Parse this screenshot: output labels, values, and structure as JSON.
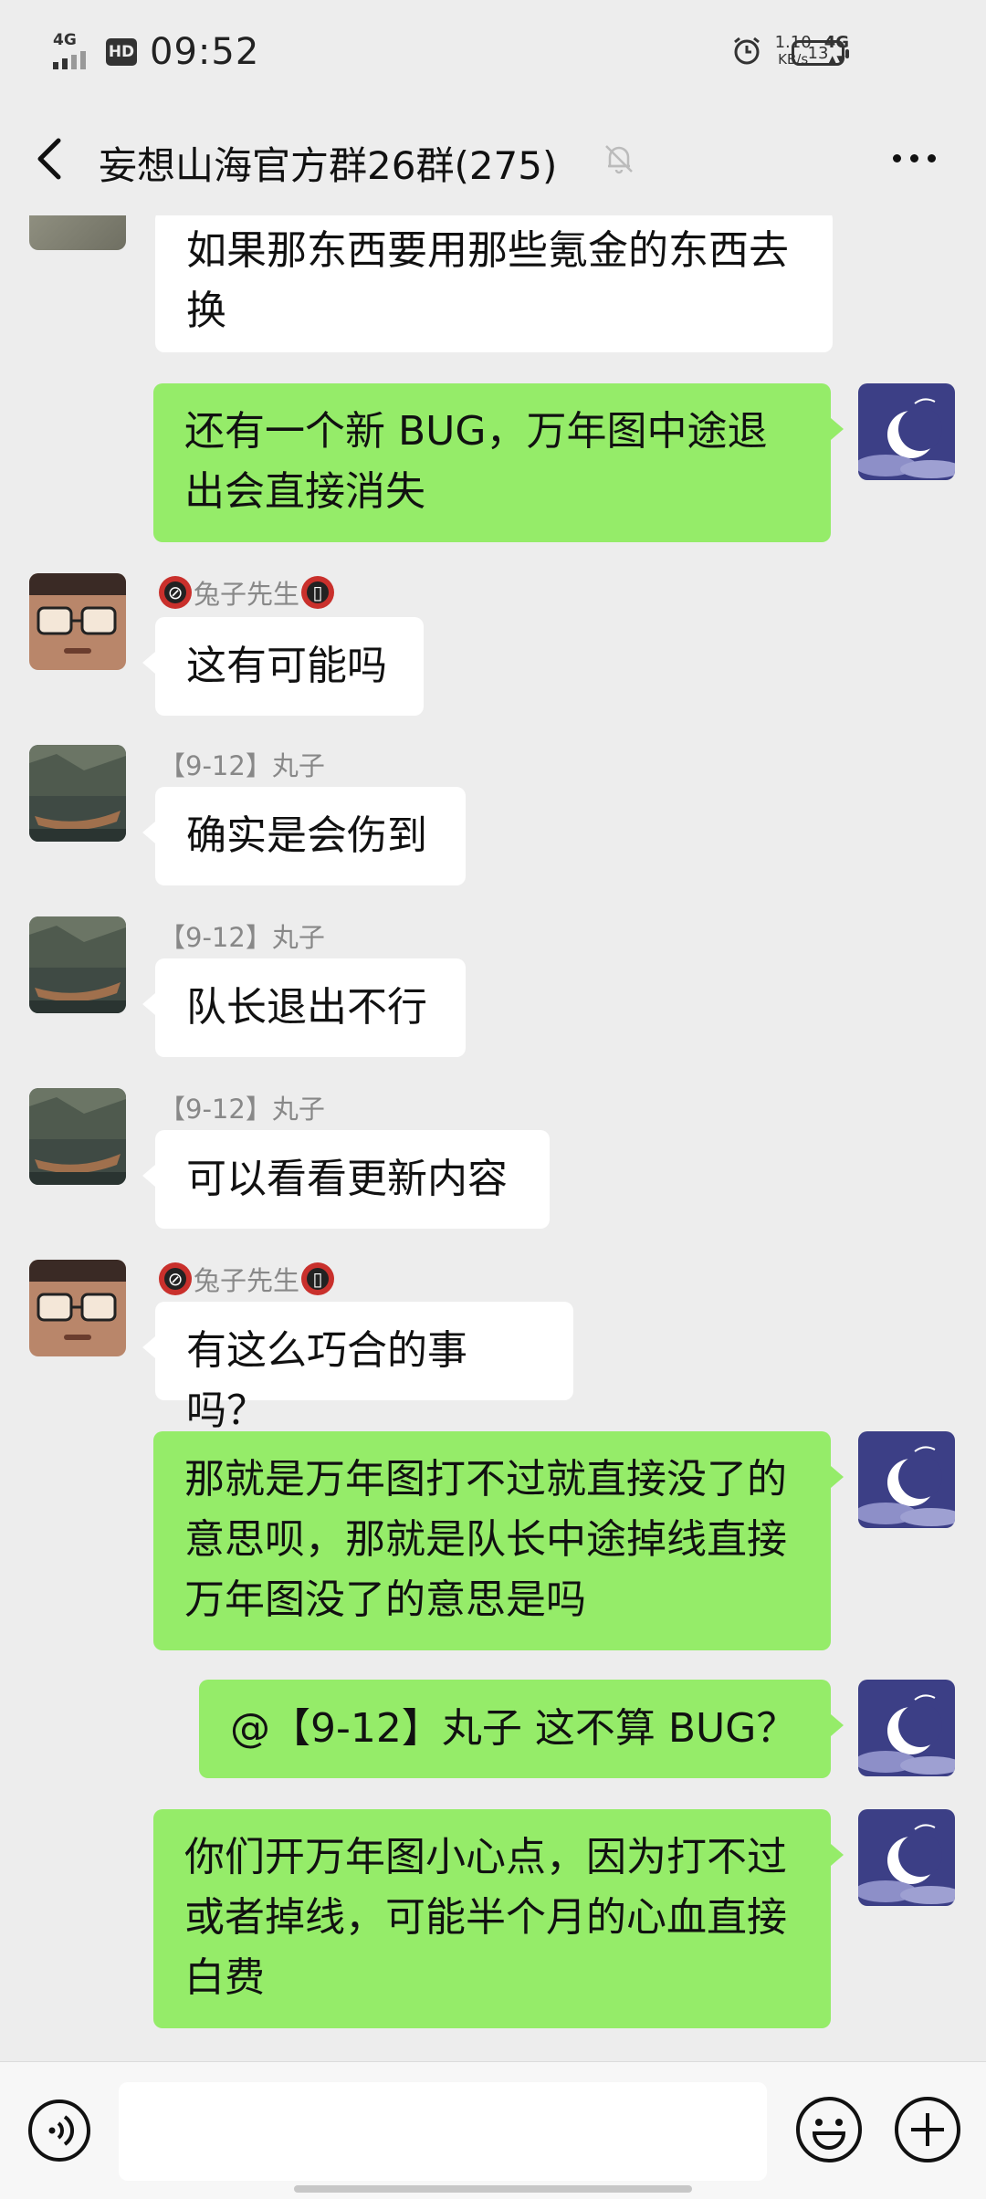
{
  "status_bar": {
    "network_label": "4G",
    "hd_label": "HD",
    "time": "09:52",
    "speed_value": "1.10",
    "speed_unit": "KB/s",
    "network_right": "4G",
    "battery": "13"
  },
  "header": {
    "title": "妄想山海官方群26群(275)"
  },
  "messages": [
    {
      "side": "left",
      "sender": "",
      "text_lines": [
        "如果那东西要用那些氪金的东西去",
        "换"
      ]
    },
    {
      "side": "right",
      "text_lines": [
        "还有一个新 BUG，万年图中途退",
        "出会直接消失"
      ]
    },
    {
      "side": "left",
      "sender": "兔子先生",
      "text_lines": [
        "这有可能吗"
      ]
    },
    {
      "side": "left",
      "sender": "【9-12】丸子",
      "text_lines": [
        "确实是会伤到"
      ]
    },
    {
      "side": "left",
      "sender": "【9-12】丸子",
      "text_lines": [
        "队长退出不行"
      ]
    },
    {
      "side": "left",
      "sender": "【9-12】丸子",
      "text_lines": [
        "可以看看更新内容"
      ]
    },
    {
      "side": "left",
      "sender": "兔子先生",
      "text_lines": [
        "有这么巧合的事吗？"
      ]
    },
    {
      "side": "right",
      "text_lines": [
        "那就是万年图打不过就直接没了的",
        "意思呗，那就是队长中途掉线直接",
        "万年图没了的意思是吗"
      ]
    },
    {
      "side": "right",
      "text_lines": [
        "@【9-12】丸子  这不算 BUG？"
      ]
    },
    {
      "side": "right",
      "text_lines": [
        "你们开万年图小心点，因为打不过",
        "或者掉线，可能半个月的心血直接",
        "白费"
      ]
    }
  ],
  "colors": {
    "background": "#ededed",
    "bubble_self": "#95ec69",
    "bubble_other": "#ffffff"
  },
  "icons": {
    "back": "chevron-left-icon",
    "mute": "bell-muted-icon",
    "more": "more-dots-icon",
    "voice": "voice-icon",
    "emoji": "emoji-icon",
    "plus": "plus-icon"
  }
}
